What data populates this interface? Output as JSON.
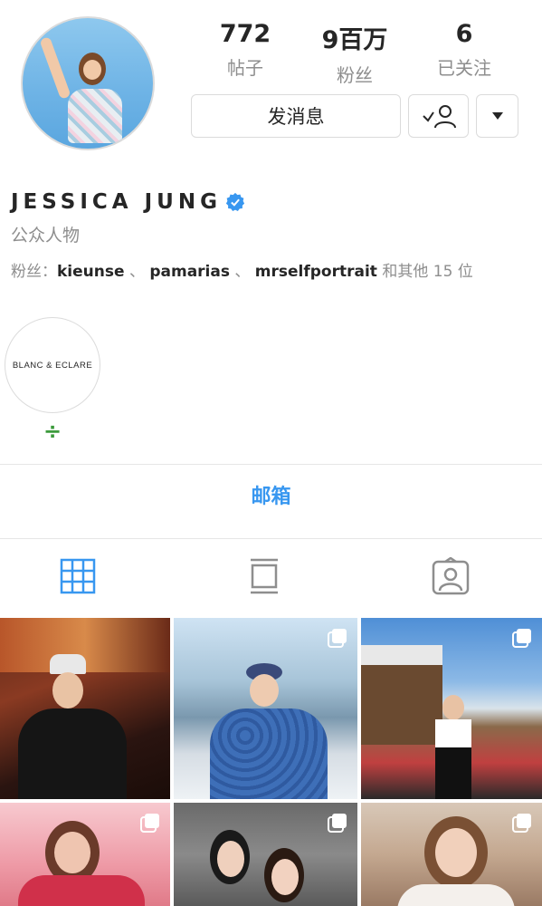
{
  "stats": [
    {
      "value": "772",
      "label": "帖子"
    },
    {
      "value": "9百万",
      "label": "粉丝"
    },
    {
      "value": "6",
      "label": "已关注"
    }
  ],
  "actions": {
    "message_label": "发消息"
  },
  "profile": {
    "username": "JESSICA JUNG",
    "category": "公众人物",
    "followed_by_prefix": "粉丝：",
    "followers": [
      "kieunse",
      "pamarias",
      "mrselfportrait"
    ],
    "separator": "、",
    "followed_by_suffix": "和其他 15 位"
  },
  "highlight": {
    "title": "BLANC & ECLARE",
    "label": "÷"
  },
  "email_label": "邮箱",
  "tabs": [
    "grid-icon",
    "feed-icon",
    "tagged-icon"
  ],
  "colors": {
    "accent": "#3897f0",
    "verified": "#3897f0",
    "muted": "#8e8e8e",
    "highlight_label": "#3b9a3b"
  }
}
